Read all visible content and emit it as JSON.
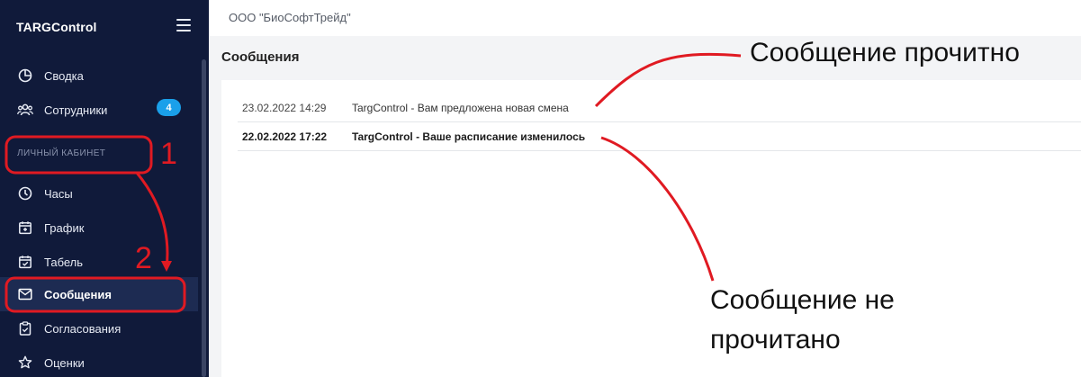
{
  "sidebar": {
    "brand": "TARGControl",
    "section_label": "ЛИЧНЫЙ КАБИНЕТ",
    "items": [
      {
        "label": "Сводка",
        "icon": "pie-chart-icon"
      },
      {
        "label": "Сотрудники",
        "icon": "users-icon",
        "badge": "4"
      },
      {
        "label": "Часы",
        "icon": "clock-icon"
      },
      {
        "label": "График",
        "icon": "calendar-plus-icon"
      },
      {
        "label": "Табель",
        "icon": "calendar-check-icon"
      },
      {
        "label": "Сообщения",
        "icon": "mail-icon",
        "active": true
      },
      {
        "label": "Согласования",
        "icon": "clipboard-check-icon"
      },
      {
        "label": "Оценки",
        "icon": "star-icon"
      }
    ]
  },
  "topbar": {
    "company": "ООО \"БиоСофтТрейд\""
  },
  "main": {
    "title": "Сообщения",
    "messages": [
      {
        "date": "23.02.2022 14:29",
        "text": "TargControl - Вам предложена новая смена",
        "read": true
      },
      {
        "date": "22.02.2022 17:22",
        "text": "TargControl - Ваше расписание изменилось",
        "read": false
      }
    ]
  },
  "annotations": {
    "read_label": "Сообщение прочитно",
    "unread_label_line1": "Сообщение не",
    "unread_label_line2": "прочитано",
    "step1": "1",
    "step2": "2"
  },
  "colors": {
    "sidebar_bg": "#101a3a",
    "active_bg": "#1d2b52",
    "badge": "#1aa0ea",
    "annotation_red": "#e01a22"
  }
}
